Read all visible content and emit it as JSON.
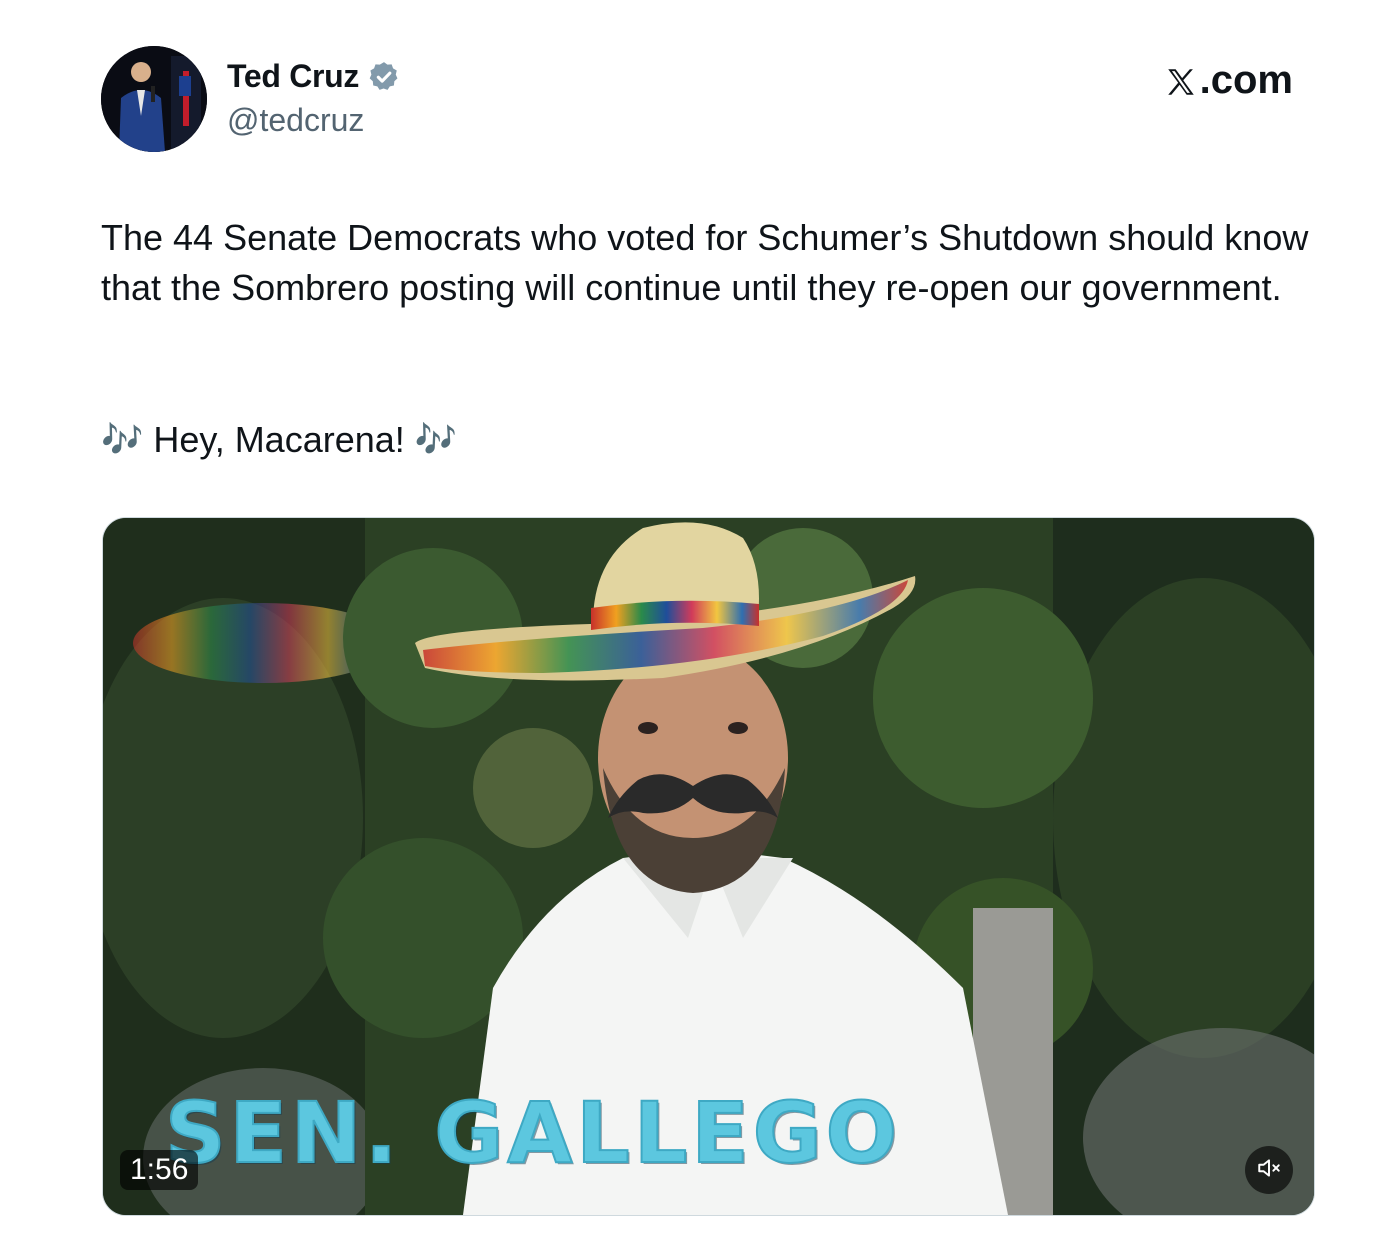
{
  "author": {
    "display_name": "Ted Cruz",
    "handle": "@tedcruz",
    "verified_color": "#829aab"
  },
  "brand": {
    "site": ".com"
  },
  "tweet": {
    "text": "The 44 Senate Democrats who voted for Schumer’s Shutdown should know that the Sombrero posting will continue until they re-open our government.",
    "line2_prefix": "🎶",
    "line2_text": "Hey, Macarena!",
    "line2_suffix": "🎶"
  },
  "video": {
    "duration": "1:56",
    "overlay_caption": "SEN. GALLEGO",
    "muted": true,
    "icons": [
      "mute-speaker-icon"
    ]
  }
}
